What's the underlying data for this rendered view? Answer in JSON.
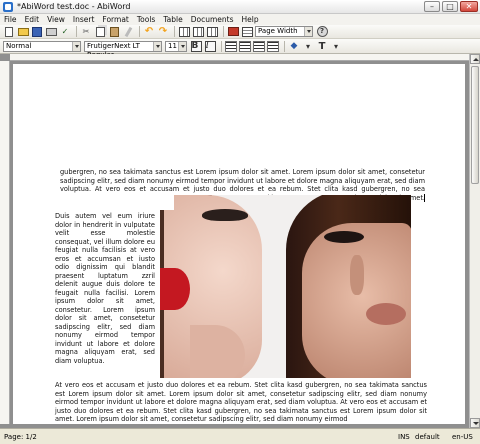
{
  "window": {
    "title": "*AbiWord test.doc - AbiWord",
    "minimize_glyph": "–",
    "maximize_glyph": "□",
    "close_glyph": "✕"
  },
  "menu": [
    "File",
    "Edit",
    "View",
    "Insert",
    "Format",
    "Tools",
    "Table",
    "Documents",
    "Help"
  ],
  "toolbar": {
    "zoom_value": "Page Width",
    "style_value": "Normal",
    "font_value": "FrutigerNext LT Regular",
    "size_value": "11",
    "bold_label": "B",
    "italic_label": "I",
    "font_color_label": "T",
    "icons": [
      "new-icon",
      "open-icon",
      "save-icon",
      "print-icon",
      "spellcheck-icon",
      "cut-icon",
      "copy-icon",
      "paste-icon",
      "format-painter-icon",
      "undo-icon",
      "redo-icon",
      "columns-icon",
      "insert-image-icon",
      "table-icon",
      "help-icon",
      "align-left-icon",
      "align-center-icon",
      "align-right-icon",
      "justify-icon",
      "fill-color-icon",
      "font-color-icon"
    ]
  },
  "document": {
    "para_top": "gubergren, no sea takimata sanctus est Lorem ipsum dolor sit amet. Lorem ipsum dolor sit amet, consetetur sadipscing elitr, sed diam nonumy eirmod tempor invidunt ut labore et dolore magna aliquyam erat, sed diam voluptua. At vero eos et accusam et justo duo dolores et ea rebum. Stet clita kasd gubergren, no sea takimata sanctus est Lorem ipsum dolor sit amet.",
    "para_left": "Duis autem vel eum iriure dolor in hendrerit in vulputate velit esse molestie consequat, vel illum dolore eu feugiat nulla facilisis at vero eros et accumsan et iusto odio dignissim qui blandit praesent luptatum zzril delenit augue duis dolore te feugait nulla facilisi. Lorem ipsum dolor sit amet, consetetur. Lorem ipsum dolor sit amet, consetetur sadipscing elitr, sed diam nonumy eirmod tempor invidunt ut labore et dolore magna aliquyam erat, sed diam voluptua.",
    "para_bottom": "At vero eos et accusam et justo duo dolores et ea rebum. Stet clita kasd gubergren, no sea takimata sanctus est Lorem ipsum dolor sit amet. Lorem ipsum dolor sit amet, consetetur sadipscing elitr, sed diam nonumy eirmod tempor invidunt ut labore et dolore magna aliquyam erat, sed diam voluptua. At vero eos et accusam et justo duo dolores et ea rebum. Stet clita kasd gubergren, no sea takimata sanctus est Lorem ipsum dolor sit amet. Lorem ipsum dolor sit amet, consetetur sadipscing elitr, sed diam nonumy eirmod"
  },
  "status": {
    "page": "Page: 1/2",
    "mode": "INS",
    "style": "default",
    "language": "en-US"
  }
}
